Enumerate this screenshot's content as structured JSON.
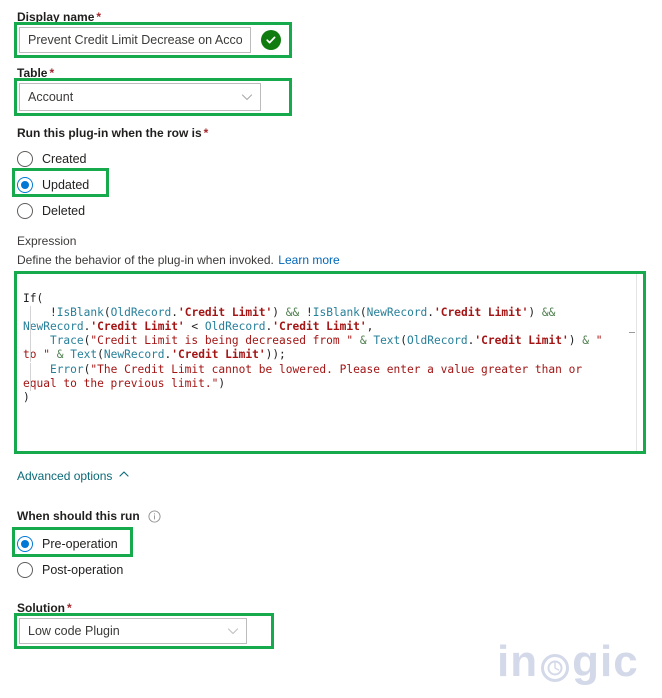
{
  "form": {
    "display_name": {
      "label": "Display name",
      "required_marker": "*",
      "value": "Prevent Credit Limit Decrease on Account",
      "valid_icon": "check-circle-icon"
    },
    "table": {
      "label": "Table",
      "required_marker": "*",
      "value": "Account",
      "chevron_icon": "chevron-down-icon"
    },
    "trigger": {
      "label": "Run this plug-in when the row is",
      "required_marker": "*",
      "options": [
        {
          "label": "Created",
          "selected": false
        },
        {
          "label": "Updated",
          "selected": true
        },
        {
          "label": "Deleted",
          "selected": false
        }
      ]
    },
    "expression": {
      "label": "Expression",
      "description": "Define the behavior of the plug-in when invoked.",
      "learn_more": "Learn more",
      "code_lines": [
        "If(",
        "    !IsBlank(OldRecord.'Credit Limit') && !IsBlank(NewRecord.'Credit Limit') && NewRecord.'Credit Limit' < OldRecord.'Credit Limit',",
        "    Trace(\"Credit Limit is being decreased from \" & Text(OldRecord.'Credit Limit') & \" to \" & Text(NewRecord.'Credit Limit'));",
        "    Error(\"The Credit Limit cannot be lowered. Please enter a value greater than or equal to the previous limit.\")",
        ")"
      ]
    },
    "advanced_options": {
      "label": "Advanced options",
      "chevron_icon": "chevron-up-icon",
      "expanded": true
    },
    "when_should_this_run": {
      "label": "When should this run",
      "info_icon": "info-circle-icon",
      "options": [
        {
          "label": "Pre-operation",
          "selected": true
        },
        {
          "label": "Post-operation",
          "selected": false
        }
      ]
    },
    "solution": {
      "label": "Solution",
      "required_marker": "*",
      "value": "Low code Plugin",
      "chevron_icon": "chevron-down-icon"
    }
  },
  "watermark": {
    "text_left": "in",
    "text_right": "gic",
    "logo_icon": "inogic-o-icon"
  },
  "colors": {
    "highlight": "#17aa4c",
    "radio_selected": "#0078d4",
    "valid_check": "#107c10",
    "required_star": "#a4262c",
    "link": "#0067b8",
    "advanced_link": "#0b6a78",
    "watermark": "#ccd3e6"
  }
}
